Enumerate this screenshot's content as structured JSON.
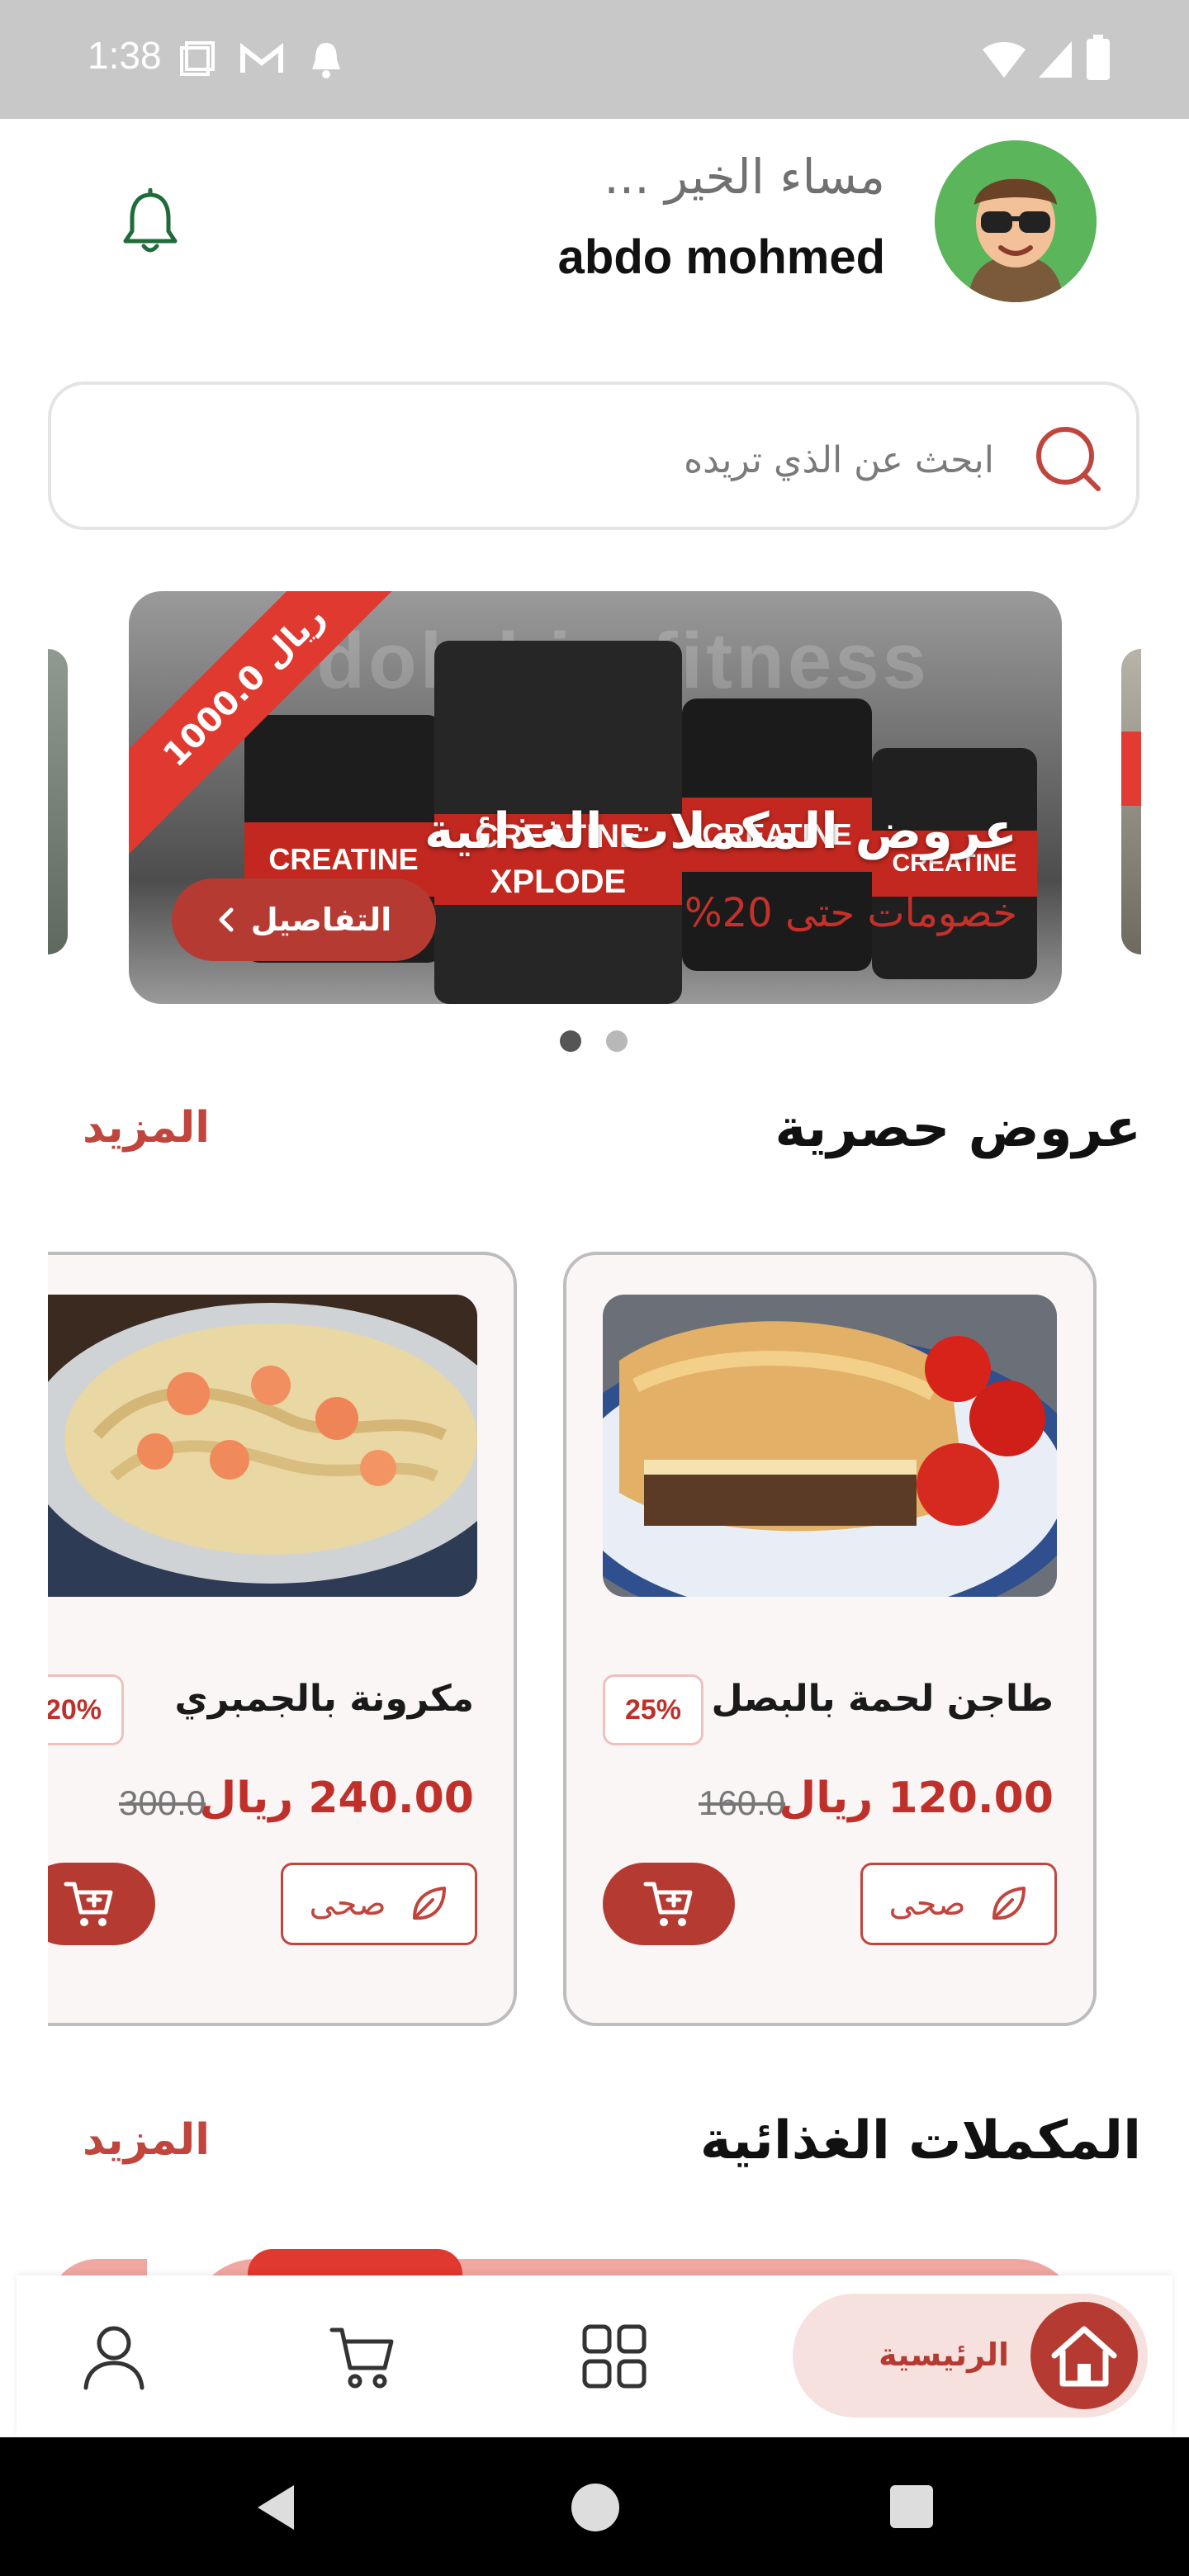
{
  "status_bar": {
    "time": "1:38"
  },
  "header": {
    "greeting": "مساء الخير ...",
    "username": "abdo mohmed"
  },
  "search": {
    "placeholder": "ابحث عن الذي تريده"
  },
  "banner": {
    "watermark": "dolphin fitness",
    "price_ribbon": "1000.0 ريال",
    "title": "عروض المكملات الغذائية",
    "subtitle": "خصومات حتى 20%",
    "details_button": "التفاصيل",
    "tub_labels": [
      "CREATINE",
      "CREATINE XPLODE",
      "CREATINE",
      "CREATINE"
    ]
  },
  "carousel": {
    "active_index": 0,
    "total": 2
  },
  "exclusive_offers": {
    "title": "عروض حصرية",
    "more": "المزيد",
    "products": [
      {
        "name": "طاجن لحمة بالبصل",
        "discount": "25%",
        "price": "120.00 ريال",
        "old_price": "160.0",
        "tag": "صحى"
      },
      {
        "name": "مكرونة بالجمبري",
        "discount": "20%",
        "price": "240.00 ريال",
        "old_price": "300.0",
        "tag": "صحى"
      }
    ]
  },
  "supplements": {
    "title": "المكملات الغذائية",
    "more": "المزيد"
  },
  "bottom_nav": {
    "home_label": "الرئيسية",
    "items": [
      "home-icon",
      "grid-icon",
      "cart-icon",
      "profile-icon"
    ]
  },
  "colors": {
    "accent": "#b53b32",
    "accent_light": "#f6e1df",
    "price_red": "#c0302a",
    "bell_green": "#1f6b3a"
  }
}
